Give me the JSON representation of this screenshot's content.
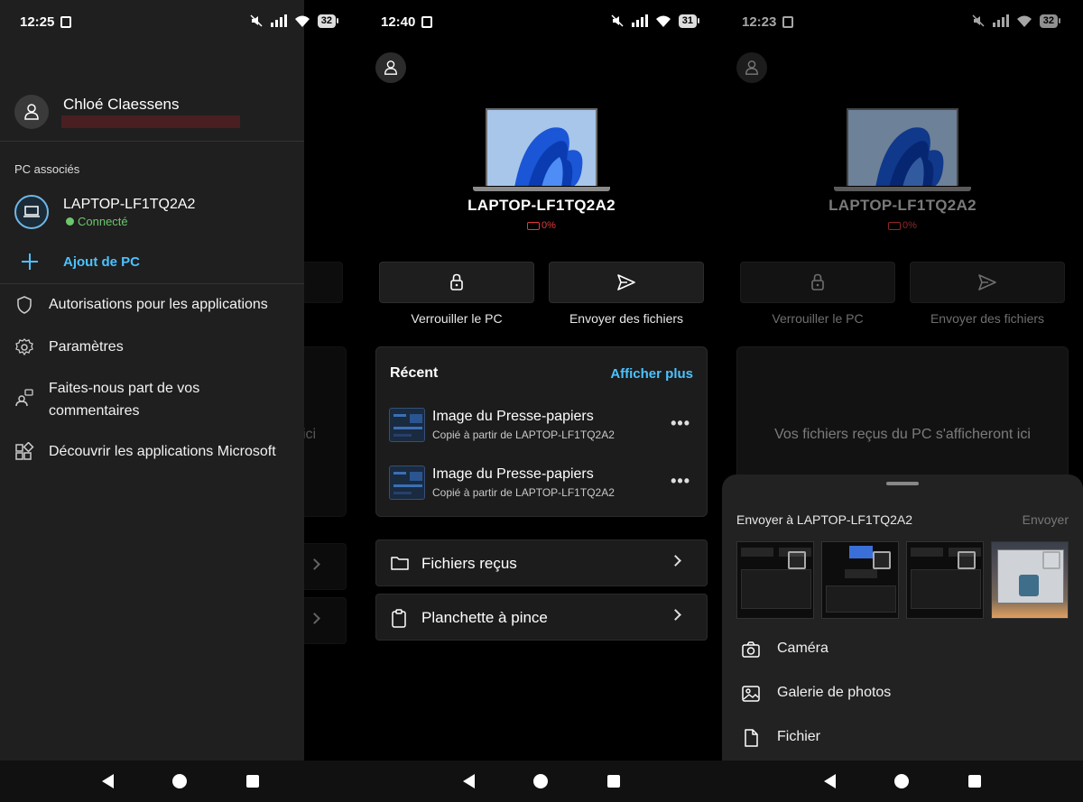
{
  "screen1": {
    "status": {
      "time": "12:25",
      "battery": "32"
    },
    "background": {
      "action_label_right_fragment": "iers",
      "empty_text_fragment": "ici"
    },
    "drawer": {
      "user_name": "Chloé Claessens",
      "section_label": "PC associés",
      "pc_name": "LAPTOP-LF1TQ2A2",
      "pc_status": "Connecté",
      "add_pc": "Ajout de PC",
      "menu": [
        {
          "icon": "shield-icon",
          "label": "Autorisations pour les applications"
        },
        {
          "icon": "gear-icon",
          "label": "Paramètres"
        },
        {
          "icon": "feedback-icon",
          "label": "Faites-nous part de vos commentaires"
        },
        {
          "icon": "apps-icon",
          "label": "Découvrir les applications Microsoft"
        }
      ]
    }
  },
  "screen2": {
    "status": {
      "time": "12:40",
      "battery": "31"
    },
    "pc_name": "LAPTOP-LF1TQ2A2",
    "battery_pct": "0%",
    "actions": {
      "lock": "Verrouiller le PC",
      "send": "Envoyer des fichiers"
    },
    "recent": {
      "title": "Récent",
      "more": "Afficher plus",
      "items": [
        {
          "name": "Image du Presse-papiers",
          "sub": "Copié à partir de LAPTOP-LF1TQ2A2",
          "dots": "•••"
        },
        {
          "name": "Image du Presse-papiers",
          "sub": "Copié à partir de LAPTOP-LF1TQ2A2",
          "dots": "•••"
        }
      ]
    },
    "rows": {
      "received": "Fichiers reçus",
      "clipboard": "Planchette à pince"
    }
  },
  "screen3": {
    "status": {
      "time": "12:23",
      "battery": "32"
    },
    "pc_name": "LAPTOP-LF1TQ2A2",
    "battery_pct": "0%",
    "actions": {
      "lock": "Verrouiller le PC",
      "send": "Envoyer des fichiers"
    },
    "empty_text": "Vos fichiers reçus du PC s'afficheront ici",
    "sheet": {
      "title": "Envoyer à LAPTOP-LF1TQ2A2",
      "send": "Envoyer",
      "options": [
        {
          "icon": "camera-icon",
          "label": "Caméra"
        },
        {
          "icon": "image-icon",
          "label": "Galerie de photos"
        },
        {
          "icon": "file-icon",
          "label": "Fichier"
        }
      ]
    }
  },
  "colors": {
    "accent": "#4cc2ff",
    "connected": "#6cc76c",
    "battery_low": "#e23b3b"
  }
}
